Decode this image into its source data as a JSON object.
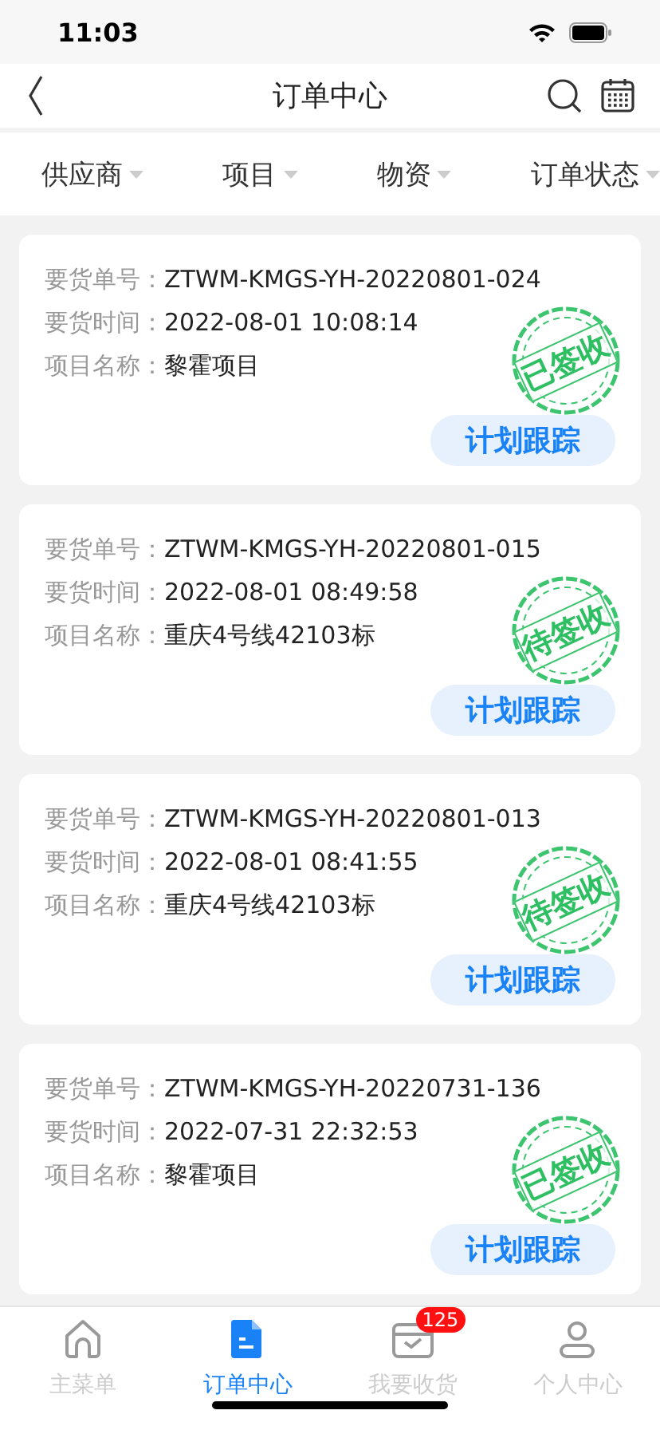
{
  "status_bar": {
    "time": "11:03"
  },
  "nav": {
    "title": "订单中心"
  },
  "filters": [
    {
      "label": "供应商"
    },
    {
      "label": "项目"
    },
    {
      "label": "物资"
    },
    {
      "label": "订单状态"
    }
  ],
  "orders": [
    {
      "order_label": "要货单号：",
      "order_no": "ZTWM-KMGS-YH-20220801-024",
      "time_label": "要货时间：",
      "time": "2022-08-01 10:08:14",
      "project_label": "项目名称：",
      "project": "黎霍项目",
      "stamp": "已签收",
      "button": "计划跟踪"
    },
    {
      "order_label": "要货单号：",
      "order_no": "ZTWM-KMGS-YH-20220801-015",
      "time_label": "要货时间：",
      "time": "2022-08-01 08:49:58",
      "project_label": "项目名称：",
      "project": "重庆4号线42103标",
      "stamp": "待签收",
      "button": "计划跟踪"
    },
    {
      "order_label": "要货单号：",
      "order_no": "ZTWM-KMGS-YH-20220801-013",
      "time_label": "要货时间：",
      "time": "2022-08-01 08:41:55",
      "project_label": "项目名称：",
      "project": "重庆4号线42103标",
      "stamp": "待签收",
      "button": "计划跟踪"
    },
    {
      "order_label": "要货单号：",
      "order_no": "ZTWM-KMGS-YH-20220731-136",
      "time_label": "要货时间：",
      "time": "2022-07-31 22:32:53",
      "project_label": "项目名称：",
      "project": "黎霍项目",
      "stamp": "已签收",
      "button": "计划跟踪"
    }
  ],
  "tabbar": [
    {
      "kind": "home",
      "label": "主菜单",
      "selected": false
    },
    {
      "kind": "doc",
      "label": "订单中心",
      "selected": true
    },
    {
      "kind": "box",
      "label": "我要收货",
      "selected": false,
      "badge": "125"
    },
    {
      "kind": "person",
      "label": "个人中心",
      "selected": false
    }
  ]
}
